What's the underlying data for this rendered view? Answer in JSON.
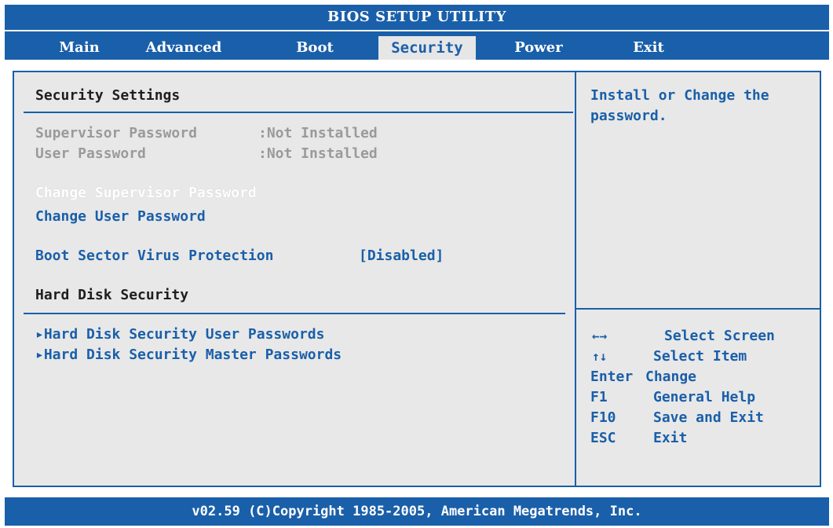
{
  "title": "BIOS SETUP UTILITY",
  "tabs": [
    {
      "label": "Main"
    },
    {
      "label": "Advanced"
    },
    {
      "label": "Boot"
    },
    {
      "label": "Security"
    },
    {
      "label": "Power"
    },
    {
      "label": "Exit"
    }
  ],
  "active_tab": "Security",
  "main": {
    "section_title": "Security Settings",
    "supervisor_password": {
      "label": "Supervisor Password",
      "value": ":Not Installed"
    },
    "user_password": {
      "label": "User Password",
      "value": ":Not Installed"
    },
    "change_supervisor": "Change Supervisor Password",
    "change_user": "Change User Password",
    "boot_sector": {
      "label": "Boot Sector Virus Protection",
      "value": "[Disabled]"
    },
    "hdd_section_title": "Hard Disk Security",
    "hdd_user": "▸Hard Disk Security User Passwords",
    "hdd_master": "▸Hard Disk Security Master Passwords"
  },
  "help": {
    "line1": "Install or Change the",
    "line2": "password."
  },
  "keys": [
    {
      "key": "←→",
      "desc": "Select Screen"
    },
    {
      "key": "↑↓",
      "desc": "Select Item"
    },
    {
      "key": "Enter",
      "desc": "Change"
    },
    {
      "key": "F1",
      "desc": "General Help"
    },
    {
      "key": "F10",
      "desc": "Save and Exit"
    },
    {
      "key": "ESC",
      "desc": "Exit"
    }
  ],
  "footer": "v02.59 (C)Copyright 1985-2005, American Megatrends, Inc.",
  "colors": {
    "accent": "#1a5fa9",
    "panel": "#e8e8e8",
    "disabled_text": "#9a9a9a"
  }
}
